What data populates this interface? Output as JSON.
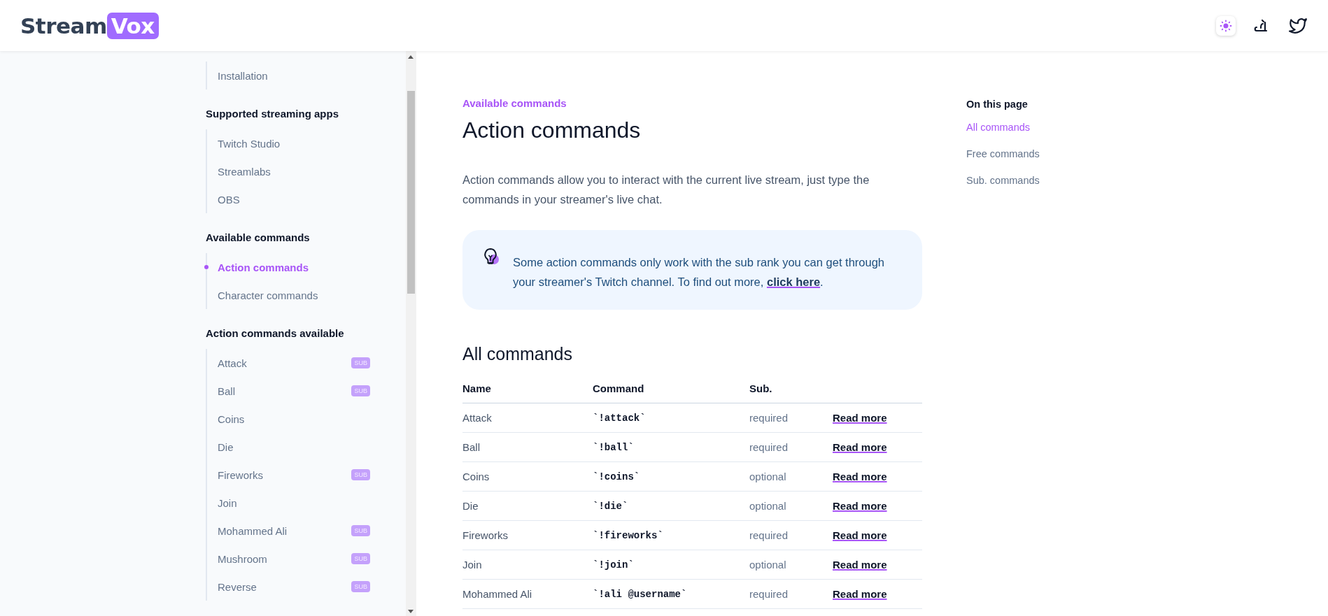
{
  "header": {
    "logo": {
      "text": "Stream",
      "highlight": "Vox"
    }
  },
  "sidebar": {
    "sections": [
      {
        "items": [
          {
            "label": "Installation",
            "selected": false
          }
        ]
      },
      {
        "heading": "Supported streaming apps",
        "items": [
          {
            "label": "Twitch Studio",
            "selected": false
          },
          {
            "label": "Streamlabs",
            "selected": false
          },
          {
            "label": "OBS",
            "selected": false
          }
        ]
      },
      {
        "heading": "Available commands",
        "items": [
          {
            "label": "Action commands",
            "selected": true
          },
          {
            "label": "Character commands",
            "selected": false
          }
        ]
      },
      {
        "heading": "Action commands available",
        "items": [
          {
            "label": "Attack",
            "selected": false,
            "badge": "SUB"
          },
          {
            "label": "Ball",
            "selected": false,
            "badge": "SUB"
          },
          {
            "label": "Coins",
            "selected": false
          },
          {
            "label": "Die",
            "selected": false
          },
          {
            "label": "Fireworks",
            "selected": false,
            "badge": "SUB"
          },
          {
            "label": "Join",
            "selected": false
          },
          {
            "label": "Mohammed Ali",
            "selected": false,
            "badge": "SUB"
          },
          {
            "label": "Mushroom",
            "selected": false,
            "badge": "SUB"
          },
          {
            "label": "Reverse",
            "selected": false,
            "badge": "SUB"
          }
        ]
      }
    ]
  },
  "main": {
    "breadcrumb": "Available commands",
    "title": "Action commands",
    "intro": "Action commands allow you to interact with the current live stream, just type the commands in your streamer's live chat.",
    "callout": {
      "text": "Some action commands only work with the sub rank you can get through your streamer's Twitch channel. To find out more, ",
      "link": "click here",
      "end": "."
    },
    "section_title": "All commands",
    "table": {
      "columns": [
        "Name",
        "Command",
        "Sub."
      ],
      "rows": [
        {
          "name": "Attack",
          "command": "`!attack`",
          "sub": "required",
          "link": "Read more"
        },
        {
          "name": "Ball",
          "command": "`!ball`",
          "sub": "required",
          "link": "Read more"
        },
        {
          "name": "Coins",
          "command": "`!coins`",
          "sub": "optional",
          "link": "Read more"
        },
        {
          "name": "Die",
          "command": "`!die`",
          "sub": "optional",
          "link": "Read more"
        },
        {
          "name": "Fireworks",
          "command": "`!fireworks`",
          "sub": "required",
          "link": "Read more"
        },
        {
          "name": "Join",
          "command": "`!join`",
          "sub": "optional",
          "link": "Read more"
        },
        {
          "name": "Mohammed Ali",
          "command": "`!ali @username`",
          "sub": "required",
          "link": "Read more"
        }
      ]
    }
  },
  "toc": {
    "title": "On this page",
    "items": [
      {
        "label": "All commands",
        "selected": true
      },
      {
        "label": "Free commands",
        "selected": false
      },
      {
        "label": "Sub. commands",
        "selected": false
      }
    ]
  }
}
